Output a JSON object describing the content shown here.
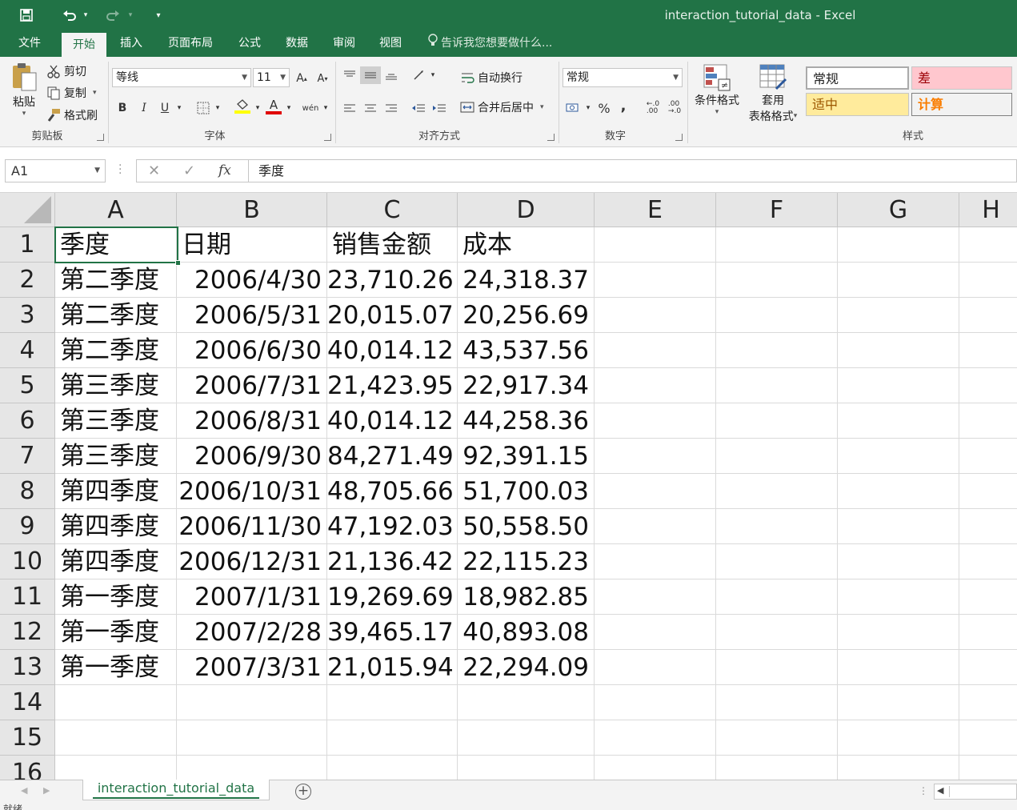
{
  "window": {
    "title": "interaction_tutorial_data - Excel"
  },
  "quick_access": {
    "save_icon": "save-icon",
    "undo_icon": "undo-icon",
    "redo_icon": "redo-icon",
    "customize_icon": "customize-icon"
  },
  "tabs": [
    {
      "label": "文件"
    },
    {
      "label": "开始"
    },
    {
      "label": "插入"
    },
    {
      "label": "页面布局"
    },
    {
      "label": "公式"
    },
    {
      "label": "数据"
    },
    {
      "label": "审阅"
    },
    {
      "label": "视图"
    }
  ],
  "tell_me": "告诉我您想要做什么...",
  "ribbon": {
    "clipboard": {
      "paste": "粘贴",
      "cut": "剪切",
      "copy": "复制",
      "format_painter": "格式刷",
      "label": "剪贴板"
    },
    "font": {
      "name": "等线",
      "size": "11",
      "label": "字体",
      "bold": "B",
      "italic": "I",
      "underline": "U"
    },
    "alignment": {
      "wrap": "自动换行",
      "merge": "合并后居中",
      "label": "对齐方式"
    },
    "number": {
      "format": "常规",
      "percent": "%",
      "comma": ",",
      "label": "数字"
    },
    "styles": {
      "conditional": "条件格式",
      "table_line1": "套用",
      "table_line2": "表格格式",
      "normal": "常规",
      "bad": "差",
      "neutral": "适中",
      "calc": "计算",
      "label": "样式"
    },
    "colors": {
      "accent": "#217346",
      "bad_bg": "#ffc7ce",
      "bad_fg": "#9c0006",
      "neutral_bg": "#ffeb9c",
      "neutral_fg": "#9c5700",
      "calc_bg": "#f2f2f2",
      "calc_fg": "#fa7d00"
    }
  },
  "formula_bar": {
    "name_box": "A1",
    "content": "季度",
    "fx": "fx"
  },
  "grid": {
    "columns": [
      "A",
      "B",
      "C",
      "D",
      "E",
      "F",
      "G",
      "H"
    ],
    "rows": [
      "1",
      "2",
      "3",
      "4",
      "5",
      "6",
      "7",
      "8",
      "9",
      "10",
      "11",
      "12",
      "13",
      "14",
      "15",
      "16"
    ],
    "cells": [
      [
        "季度",
        "日期",
        "销售金额",
        "成本"
      ],
      [
        "第二季度",
        "2006/4/30",
        "23,710.26",
        "24,318.37"
      ],
      [
        "第二季度",
        "2006/5/31",
        "20,015.07",
        "20,256.69"
      ],
      [
        "第二季度",
        "2006/6/30",
        "40,014.12",
        "43,537.56"
      ],
      [
        "第三季度",
        "2006/7/31",
        "21,423.95",
        "22,917.34"
      ],
      [
        "第三季度",
        "2006/8/31",
        "40,014.12",
        "44,258.36"
      ],
      [
        "第三季度",
        "2006/9/30",
        "84,271.49",
        "92,391.15"
      ],
      [
        "第四季度",
        "2006/10/31",
        "48,705.66",
        "51,700.03"
      ],
      [
        "第四季度",
        "2006/11/30",
        "47,192.03",
        "50,558.50"
      ],
      [
        "第四季度",
        "2006/12/31",
        "21,136.42",
        "22,115.23"
      ],
      [
        "第一季度",
        "2007/1/31",
        "19,269.69",
        "18,982.85"
      ],
      [
        "第一季度",
        "2007/2/28",
        "39,465.17",
        "40,893.08"
      ],
      [
        "第一季度",
        "2007/3/31",
        "21,015.94",
        "22,294.09"
      ]
    ]
  },
  "sheet_tabs": [
    {
      "label": "interaction_tutorial_data",
      "active": true
    }
  ],
  "status": {
    "text": "就绪"
  }
}
